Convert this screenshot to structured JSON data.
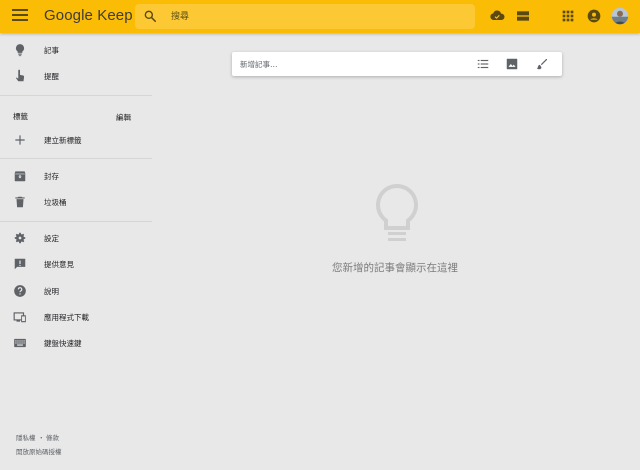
{
  "header": {
    "menu_icon": "hamburger-menu-icon",
    "logo": "Google Keep",
    "search_placeholder": "搜尋",
    "icons": [
      "cloud-sync-icon",
      "list-view-icon",
      "apps-grid-icon",
      "account-circle-icon",
      "avatar"
    ],
    "accent_color": "#fbbc05"
  },
  "sidebar": {
    "top_items": [
      {
        "label": "記事",
        "icon": "lightbulb-icon"
      },
      {
        "label": "提醒",
        "icon": "reminder-hand-icon"
      }
    ],
    "labels_section": {
      "title": "標籤",
      "edit": "編輯"
    },
    "create_label": {
      "label": "建立新標籤",
      "icon": "plus-icon"
    },
    "storage_items": [
      {
        "label": "封存",
        "icon": "archive-icon"
      },
      {
        "label": "垃圾桶",
        "icon": "trash-icon"
      }
    ],
    "misc_items": [
      {
        "label": "設定",
        "icon": "gear-icon"
      },
      {
        "label": "提供意見",
        "icon": "feedback-icon"
      },
      {
        "label": "說明",
        "icon": "help-icon"
      },
      {
        "label": "應用程式下載",
        "icon": "devices-icon"
      },
      {
        "label": "鍵盤快速鍵",
        "icon": "keyboard-icon"
      }
    ],
    "footer": {
      "privacy": "隱私權",
      "separator": "・",
      "terms": "條款",
      "licenses": "開放原始碼授權"
    }
  },
  "composer": {
    "placeholder": "新增記事…",
    "buttons": [
      "checklist-icon",
      "image-icon",
      "brush-icon"
    ]
  },
  "empty_state": {
    "icon": "lightbulb-outline-icon",
    "message": "您新增的記事會顯示在這裡"
  }
}
